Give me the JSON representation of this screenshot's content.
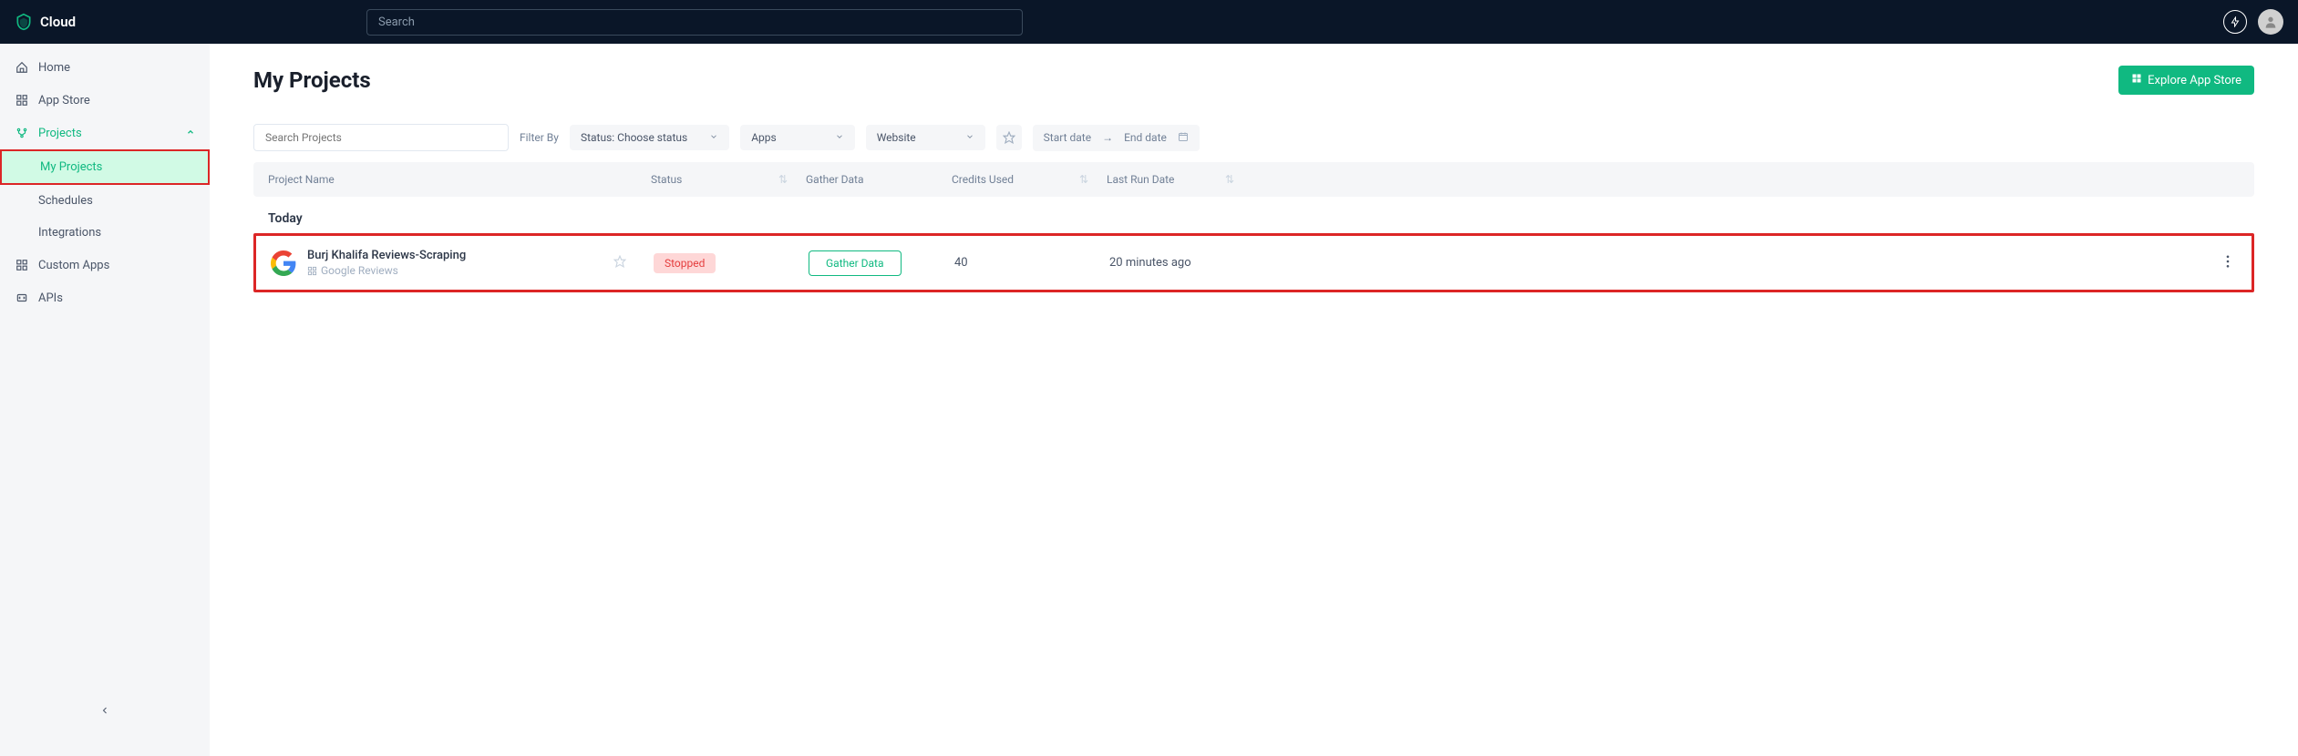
{
  "brand": "Cloud",
  "search_placeholder": "Search",
  "sidebar": {
    "items": [
      {
        "label": "Home"
      },
      {
        "label": "App Store"
      },
      {
        "label": "Projects"
      },
      {
        "label": "Custom Apps"
      },
      {
        "label": "APIs"
      }
    ],
    "projects_sub": [
      {
        "label": "My Projects"
      },
      {
        "label": "Schedules"
      },
      {
        "label": "Integrations"
      }
    ]
  },
  "page": {
    "title": "My Projects",
    "explore_btn": "Explore App Store"
  },
  "filters": {
    "search_placeholder": "Search Projects",
    "filterby_label": "Filter By",
    "status_label": "Status: Choose status",
    "apps_label": "Apps",
    "website_label": "Website",
    "startdate_label": "Start date",
    "enddate_label": "End date"
  },
  "table": {
    "columns": {
      "name": "Project Name",
      "status": "Status",
      "gather": "Gather Data",
      "credits": "Credits Used",
      "lastrun": "Last Run Date"
    },
    "section": "Today",
    "row": {
      "name": "Burj Khalifa Reviews-Scraping",
      "app": "Google Reviews",
      "status": "Stopped",
      "gather_btn": "Gather Data",
      "credits": "40",
      "lastrun": "20 minutes ago"
    }
  }
}
